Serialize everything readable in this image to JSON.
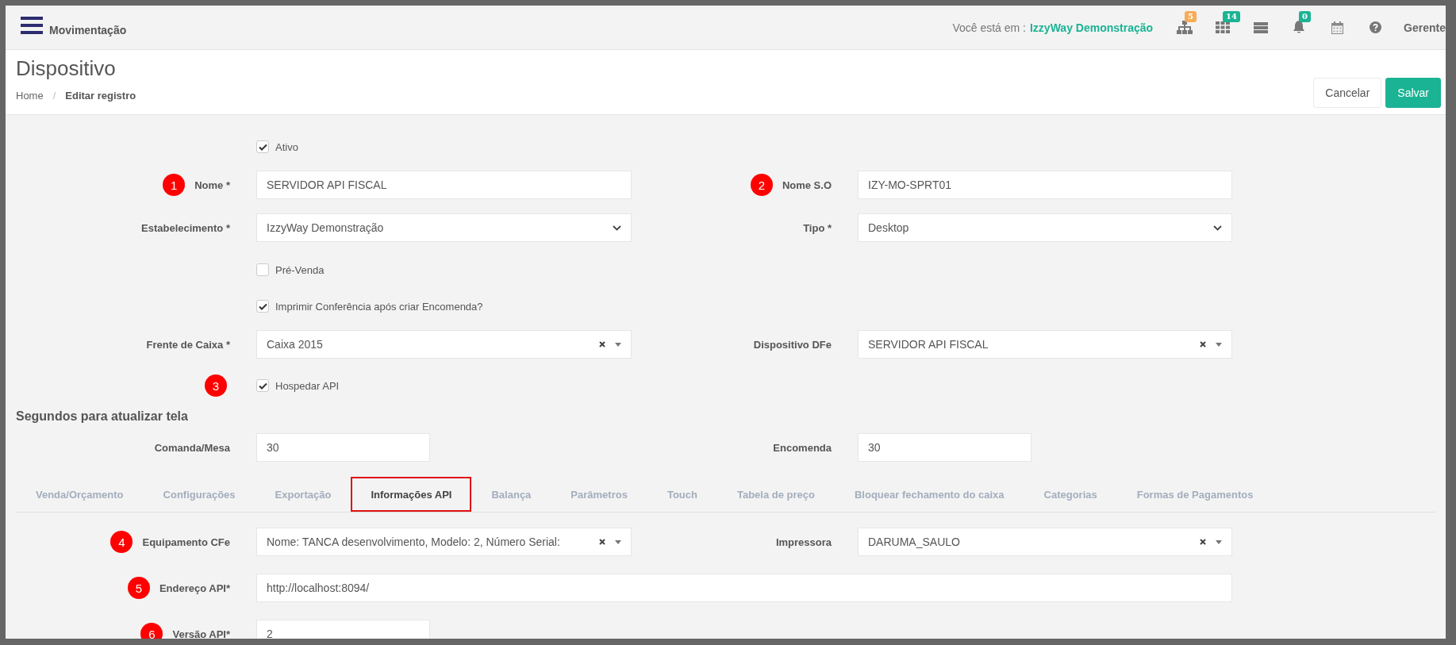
{
  "topbar": {
    "title": "Movimentação",
    "context_prefix": "Você está em :",
    "context_value": "IzzyWay Demonstração",
    "user": "Gerente",
    "icons": [
      {
        "kind": "sitemap",
        "badge": "5",
        "color": "#f8ac59"
      },
      {
        "kind": "grid",
        "badge": "14",
        "color": "#1ab394"
      },
      {
        "kind": "server"
      },
      {
        "kind": "bell",
        "badge": "0",
        "color": "#1ab394"
      },
      {
        "kind": "calendar"
      },
      {
        "kind": "help"
      }
    ]
  },
  "header": {
    "title": "Dispositivo",
    "separator": "/",
    "breadcrumb": [
      {
        "label": "Home",
        "current": false
      },
      {
        "label": "Editar registro",
        "current": true
      }
    ],
    "buttons": [
      {
        "label": "Cancelar",
        "kind": "default"
      },
      {
        "label": "Salvar",
        "kind": "primary"
      }
    ]
  },
  "form": {
    "rows": [
      [
        {
          "kind": "checkbox",
          "label": "Ativo",
          "checked": true
        }
      ],
      [
        {
          "kind": "text",
          "label": "Nome *",
          "value": "SERVIDOR API FISCAL",
          "marker": "1"
        },
        {
          "kind": "text",
          "label": "Nome S.O",
          "value": "IZY-MO-SPRT01",
          "marker": "2"
        }
      ],
      [
        {
          "kind": "select",
          "label": "Estabelecimento *",
          "value": "IzzyWay Demonstração"
        },
        {
          "kind": "select",
          "label": "Tipo *",
          "value": "Desktop"
        }
      ],
      [
        {
          "kind": "checkbox",
          "label": "Pré-Venda",
          "checked": false
        }
      ],
      [
        {
          "kind": "checkbox",
          "label": "Imprimir Conferência após criar Encomenda?",
          "checked": true
        }
      ],
      [
        {
          "kind": "combo",
          "label": "Frente de Caixa *",
          "value": "Caixa 2015"
        },
        {
          "kind": "combo",
          "label": "Dispositivo DFe",
          "value": "SERVIDOR API FISCAL"
        }
      ],
      [
        {
          "kind": "checkbox",
          "label": "Hospedar API",
          "checked": true,
          "marker": "3"
        }
      ]
    ]
  },
  "refresh": {
    "heading": "Segundos para atualizar tela",
    "fields": [
      {
        "label": "Comanda/Mesa",
        "value": "30"
      },
      {
        "label": "Encomenda",
        "value": "30"
      }
    ]
  },
  "tabs": [
    {
      "label": "Venda/Orçamento",
      "selected": false
    },
    {
      "label": "Configurações",
      "selected": false
    },
    {
      "label": "Exportação",
      "selected": false
    },
    {
      "label": "Informações API",
      "selected": true
    },
    {
      "label": "Balança",
      "selected": false
    },
    {
      "label": "Parâmetros",
      "selected": false
    },
    {
      "label": "Touch",
      "selected": false
    },
    {
      "label": "Tabela de preço",
      "selected": false
    },
    {
      "label": "Bloquear fechamento do caixa",
      "selected": false
    },
    {
      "label": "Categorias",
      "selected": false
    },
    {
      "label": "Formas de Pagamentos",
      "selected": false
    }
  ],
  "tab_form": {
    "rows": [
      [
        {
          "kind": "combo",
          "label": "Equipamento CFe",
          "value": "Nome: TANCA desenvolvimento, Modelo: 2, Número Serial:",
          "marker": "4"
        },
        {
          "kind": "combo",
          "label": "Impressora",
          "value": "DARUMA_SAULO"
        }
      ],
      [
        {
          "kind": "wide",
          "label": "Endereço API*",
          "value": "http://localhost:8094/",
          "marker": "5"
        }
      ],
      [
        {
          "kind": "short",
          "label": "Versão API*",
          "value": "2",
          "marker": "6"
        }
      ]
    ]
  }
}
